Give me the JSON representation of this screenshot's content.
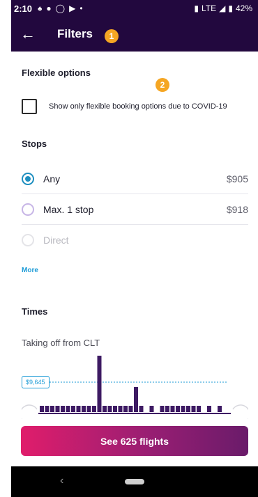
{
  "status_bar": {
    "time": "2:10",
    "notification_icons": [
      "snapchat-icon",
      "messenger-icon",
      "bag-icon",
      "youtube-icon",
      "dot-icon"
    ],
    "network": "LTE",
    "battery": "42%"
  },
  "header": {
    "title": "Filters",
    "back_icon": "arrow-left-icon",
    "background": "#22083e"
  },
  "badges": {
    "one": "1",
    "two": "2"
  },
  "flexible_options": {
    "title": "Flexible options",
    "checkbox_label": "Show only flexible booking options due to COVID-19",
    "checked": false
  },
  "stops": {
    "title": "Stops",
    "options": [
      {
        "label": "Any",
        "price": "$905",
        "selected": true
      },
      {
        "label": "Max. 1 stop",
        "price": "$918",
        "selected": false
      },
      {
        "label": "Direct",
        "price": "",
        "selected": false,
        "disabled": true
      }
    ],
    "more_link": "More"
  },
  "times": {
    "title": "Times",
    "subtitle": "Taking off from CLT",
    "price_marker": "$9,645",
    "histogram_bars": [
      1,
      1,
      1,
      1,
      1,
      1,
      1,
      1,
      1,
      1,
      1,
      9,
      1,
      1,
      1,
      1,
      1,
      1,
      4,
      1,
      0,
      1,
      0,
      1,
      1,
      1,
      1,
      1,
      1,
      1,
      1,
      0,
      1,
      0,
      1,
      0
    ]
  },
  "cta": {
    "label": "See 625 flights"
  },
  "colors": {
    "accent": "#1a9ad6",
    "brand_dark": "#22083e",
    "histogram": "#3d1a63",
    "badge": "#f5a623"
  }
}
